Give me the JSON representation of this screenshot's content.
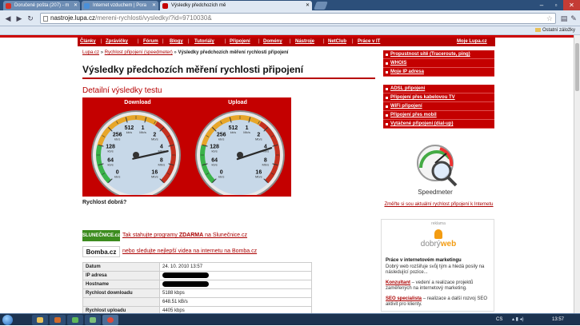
{
  "browser": {
    "tabs": [
      {
        "label": "Doručené pošta (207) - m",
        "favicon_color": "#d93025"
      },
      {
        "label": "Internet vzduchem | Pora",
        "favicon_color": "#4a90d9"
      },
      {
        "label": "Výsledky předchozích mě",
        "favicon_color": "#c40000"
      }
    ],
    "url_host": "nastroje.lupa.cz",
    "url_path": "/mereni-rychlosti/vysledky/?id=9710030&",
    "bookmark_other": "Ostatní záložky"
  },
  "nav": {
    "items": [
      "Články",
      "Zprávičky",
      "Fórum",
      "Blogy",
      "Tutoriály",
      "Připojení",
      "Domény",
      "Nástroje",
      "NetClub",
      "Práce v IT"
    ],
    "right": "Moje Lupa.cz"
  },
  "breadcrumb": {
    "home": "Lupa.cz",
    "sep1": "»",
    "section": "Rychlost připojení (speedmeter)",
    "sep2": "»",
    "current": "Výsledky předchozích měření rychlosti připojení"
  },
  "page_title": "Výsledky předchozích měření rychlosti připojení",
  "detail_title": "Detailní výsledky testu",
  "gauges": [
    {
      "label": "Download",
      "value_kbps": 5188,
      "ticks": [
        {
          "v": "0",
          "u": "kb/s"
        },
        {
          "v": "64",
          "u": "kb/s"
        },
        {
          "v": "128",
          "u": "kb/s"
        },
        {
          "v": "256",
          "u": "kb/s"
        },
        {
          "v": "512",
          "u": "kb/s"
        },
        {
          "v": "1",
          "u": "Mb/s"
        },
        {
          "v": "2",
          "u": "Mb/s"
        },
        {
          "v": "4",
          "u": "Mb/s"
        },
        {
          "v": "8",
          "u": "Mb/s"
        },
        {
          "v": "16",
          "u": "Mb/s"
        }
      ]
    },
    {
      "label": "Upload",
      "value_kbps": 4405,
      "ticks": [
        {
          "v": "0",
          "u": "kb/s"
        },
        {
          "v": "64",
          "u": "kb/s"
        },
        {
          "v": "128",
          "u": "kb/s"
        },
        {
          "v": "256",
          "u": "kb/s"
        },
        {
          "v": "512",
          "u": "kb/s"
        },
        {
          "v": "1",
          "u": "Mb/s"
        },
        {
          "v": "2",
          "u": "Mb/s"
        },
        {
          "v": "4",
          "u": "Mb/s"
        },
        {
          "v": "8",
          "u": "Mb/s"
        },
        {
          "v": "16",
          "u": "Mb/s"
        }
      ]
    }
  ],
  "speed_question": "Rychlost dobrá?",
  "promos": [
    {
      "logo": "SLUNEČNICE.cz",
      "logo_bg": "#3c8c1e",
      "logo_fg": "#fff",
      "prefix": "Tak stahujte programy ",
      "bold": "ZDARMA",
      "suffix": " na Slunečnice.cz"
    },
    {
      "logo": "Bomba.cz",
      "logo_bg": "#ffffff",
      "logo_fg": "#111",
      "prefix": "nebo sledujte nejlepší videa na internetu na Bomba.cz",
      "bold": "",
      "suffix": ""
    }
  ],
  "results": [
    {
      "key": "Datum",
      "value": "24. 10. 2010 13:57",
      "redacted": false
    },
    {
      "key": "IP adresa",
      "value": "",
      "redacted": true
    },
    {
      "key": "Hostname",
      "value": "",
      "redacted": true
    },
    {
      "key": "Rychlost downloadu",
      "value": "5188 kbps",
      "redacted": false
    },
    {
      "key": "",
      "value": "648.51 kB/s",
      "redacted": false
    },
    {
      "key": "Rychlost uploadu",
      "value": "4405 kbps",
      "redacted": false
    }
  ],
  "sidebar": {
    "group1": [
      "Propustnost sítě (Traceroute, ping)",
      "WHOIS",
      "Moje IP adresa"
    ],
    "group2": [
      "ADSL připojení",
      "Připojení přes kabelovou TV",
      "WiFi připojení",
      "Připojení přes mobil",
      "Vytáčené připojení (dial-up)"
    ],
    "speedmeter_logo": "Speedmeter",
    "speedmeter_link": "Změřte si sou aktuální rychlost připojení k Internetu"
  },
  "ad": {
    "tag": "reklama",
    "logo_a": "dobrý",
    "logo_b": "web",
    "heading": "Práce v internetovém marketingu",
    "intro": "Dobrý web rozšiřuje svůj tým a hledá posily na následující pozice...",
    "job1_link": "Konzultant",
    "job1_text": " – vedení a realizace projektů zaměřených na internetový marketing.",
    "job2_link": "SEO specialista",
    "job2_text": " – realizace a další rozvoj SEO aktivit pro klienty."
  },
  "taskbar": {
    "lang": "CS",
    "clock": "13:57"
  }
}
